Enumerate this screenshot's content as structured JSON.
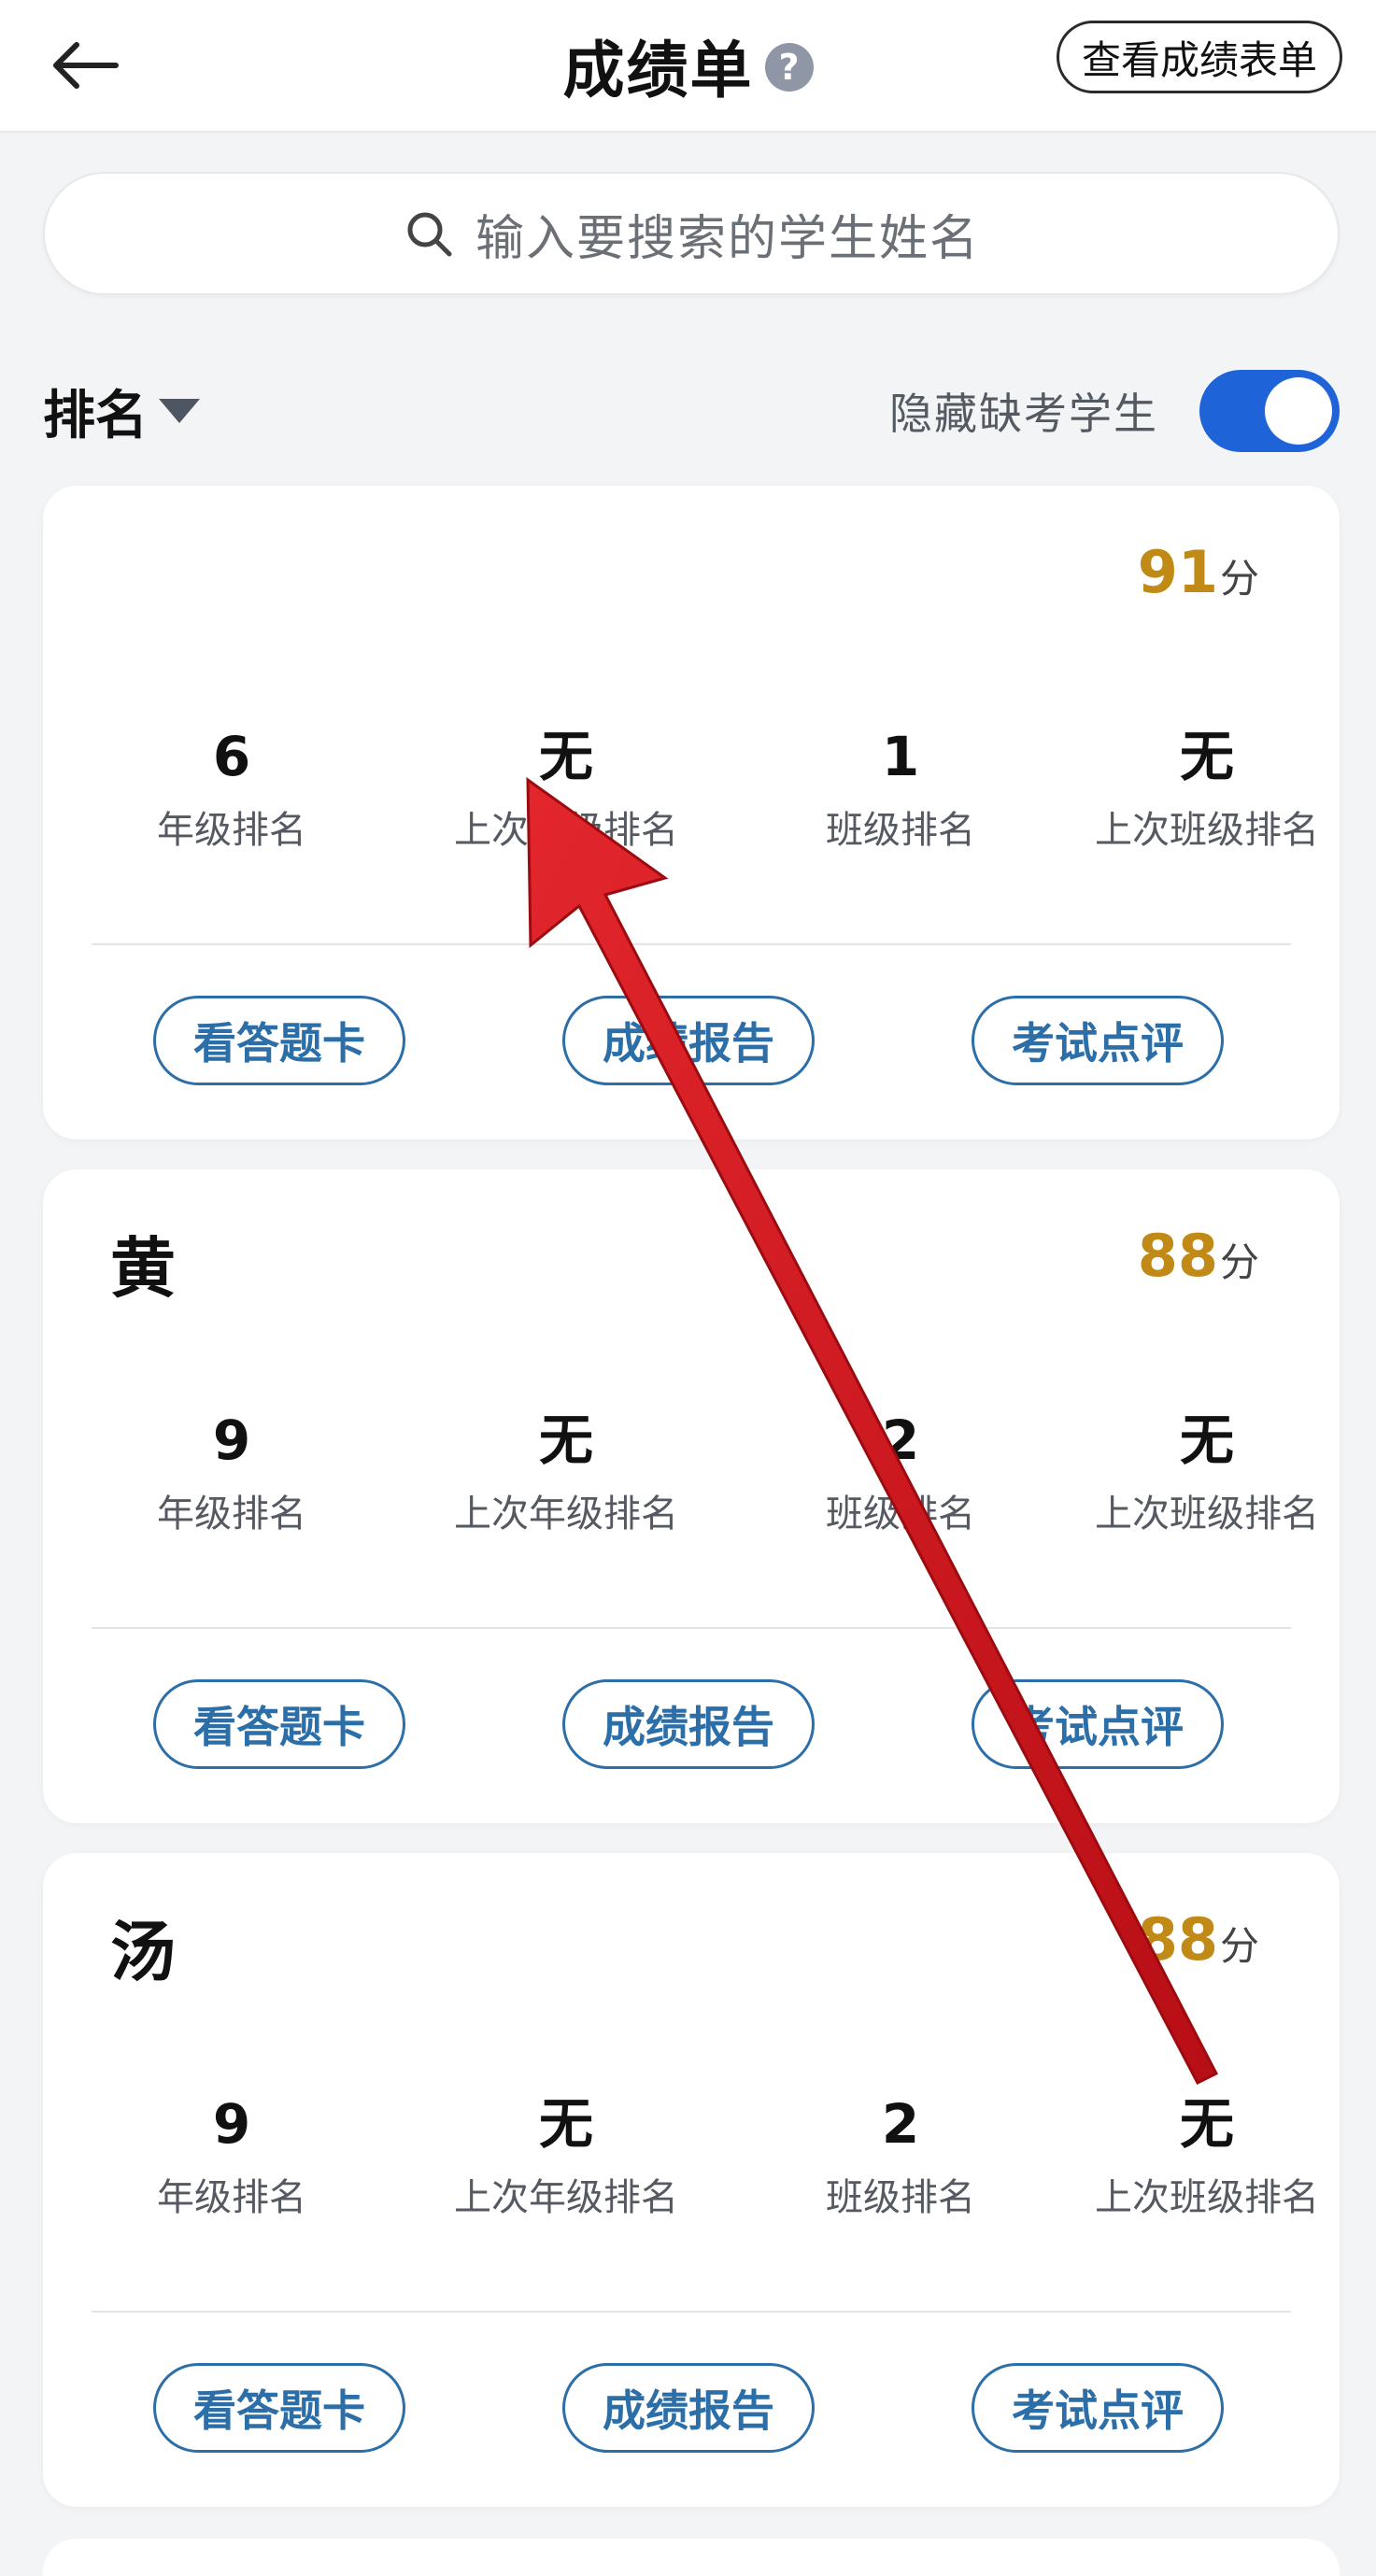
{
  "header": {
    "back_label": "back",
    "title": "成绩单",
    "help_glyph": "?",
    "view_table_label": "查看成绩表单"
  },
  "search": {
    "placeholder": "输入要搜索的学生姓名",
    "icon": "search-icon"
  },
  "filter": {
    "sort_label": "排名",
    "hide_absent_label": "隐藏缺考学生",
    "hide_absent_on": true,
    "toggle_color": "#1e63d8"
  },
  "stat_labels": {
    "grade_rank": "年级排名",
    "prev_grade_rank": "上次年级排名",
    "class_rank": "班级排名",
    "prev_class_rank": "上次班级排名"
  },
  "action_labels": {
    "answer_sheet": "看答题卡",
    "score_report": "成绩报告",
    "exam_comment": "考试点评"
  },
  "score_unit": "分",
  "students": [
    {
      "name": "",
      "score": "91",
      "grade_rank": "6",
      "prev_grade_rank": "无",
      "class_rank": "1",
      "prev_class_rank": "无"
    },
    {
      "name": "黄",
      "score": "88",
      "grade_rank": "9",
      "prev_grade_rank": "无",
      "class_rank": "2",
      "prev_class_rank": "无"
    },
    {
      "name": "汤",
      "score": "88",
      "grade_rank": "9",
      "prev_grade_rank": "无",
      "class_rank": "2",
      "prev_class_rank": "无"
    }
  ],
  "colors": {
    "score": "#c18a16",
    "action_border": "#2b6ea8",
    "annotation_arrow": "#d8141c"
  }
}
